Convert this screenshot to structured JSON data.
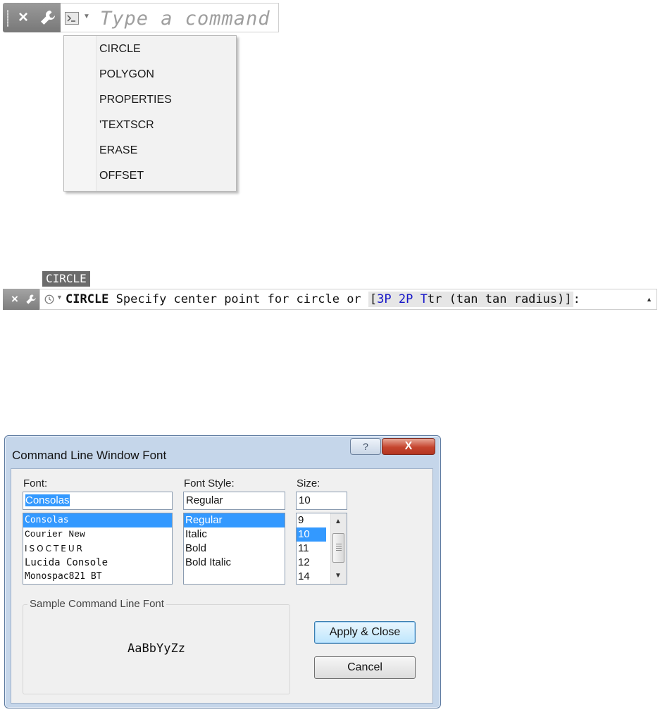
{
  "command_bar": {
    "close_glyph": "×",
    "placeholder": "Type a command"
  },
  "recent_menu": {
    "items": [
      "CIRCLE",
      "POLYGON",
      "PROPERTIES",
      "'TEXTSCR",
      "ERASE",
      "OFFSET"
    ]
  },
  "circle_prompt": {
    "tooltip": "CIRCLE",
    "close_glyph": "×",
    "command": "CIRCLE",
    "prompt": "Specify center point for circle or",
    "bracket_open": "[",
    "bracket_close": "]",
    "options": [
      {
        "key": "3P",
        "rest": ""
      },
      {
        "key": "2P",
        "rest": ""
      },
      {
        "key": "T",
        "rest": "tr (tan tan radius)"
      }
    ],
    "colon": ":"
  },
  "dialog": {
    "title": "Command Line Window Font",
    "help_label": "?",
    "close_label": "X",
    "font": {
      "label": "Font:",
      "value": "Consolas",
      "options": [
        "Consolas",
        "Courier New",
        "ISOCTEUR",
        "Lucida Console",
        "Monospac821 BT"
      ],
      "selected_index": 0
    },
    "style": {
      "label": "Font Style:",
      "value": "Regular",
      "options": [
        "Regular",
        "Italic",
        "Bold",
        "Bold Italic"
      ],
      "selected_index": 0
    },
    "size": {
      "label": "Size:",
      "value": "10",
      "options": [
        "9",
        "10",
        "11",
        "12",
        "14"
      ],
      "selected_index": 1
    },
    "sample": {
      "label": "Sample Command Line Font",
      "text": "AaBbYyZz"
    },
    "buttons": {
      "apply": "Apply & Close",
      "cancel": "Cancel"
    }
  },
  "colors": {
    "selection": "#3399ff",
    "option_blue": "#1515c8",
    "close_red": "#c5452f"
  },
  "icons": [
    "close-icon",
    "wrench-icon",
    "command-prompt-icon",
    "chevron-down-icon",
    "clock-icon",
    "help-icon",
    "scroll-up-icon",
    "scroll-down-icon"
  ]
}
